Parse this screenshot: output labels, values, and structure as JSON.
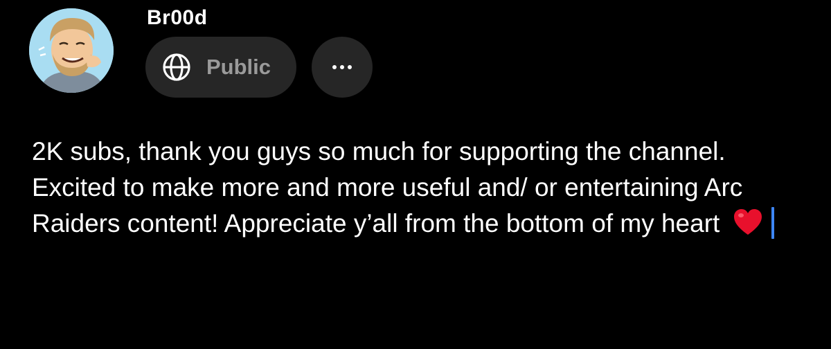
{
  "post": {
    "username": "Br00d",
    "visibility_label": "Public",
    "visibility_icon": "globe-icon",
    "more_icon": "more-horizontal-icon",
    "body_text": "2K subs, thank you guys so much for supporting the channel. Excited to make more and more useful and/ or entertaining Arc Raiders content! Appreciate y’all from the bottom of my heart",
    "trailing_emoji": "heart-icon"
  },
  "colors": {
    "background": "#000000",
    "pill": "#262626",
    "muted_text": "#9a9a9a",
    "cursor": "#3d86f6",
    "heart": "#e8102c"
  }
}
